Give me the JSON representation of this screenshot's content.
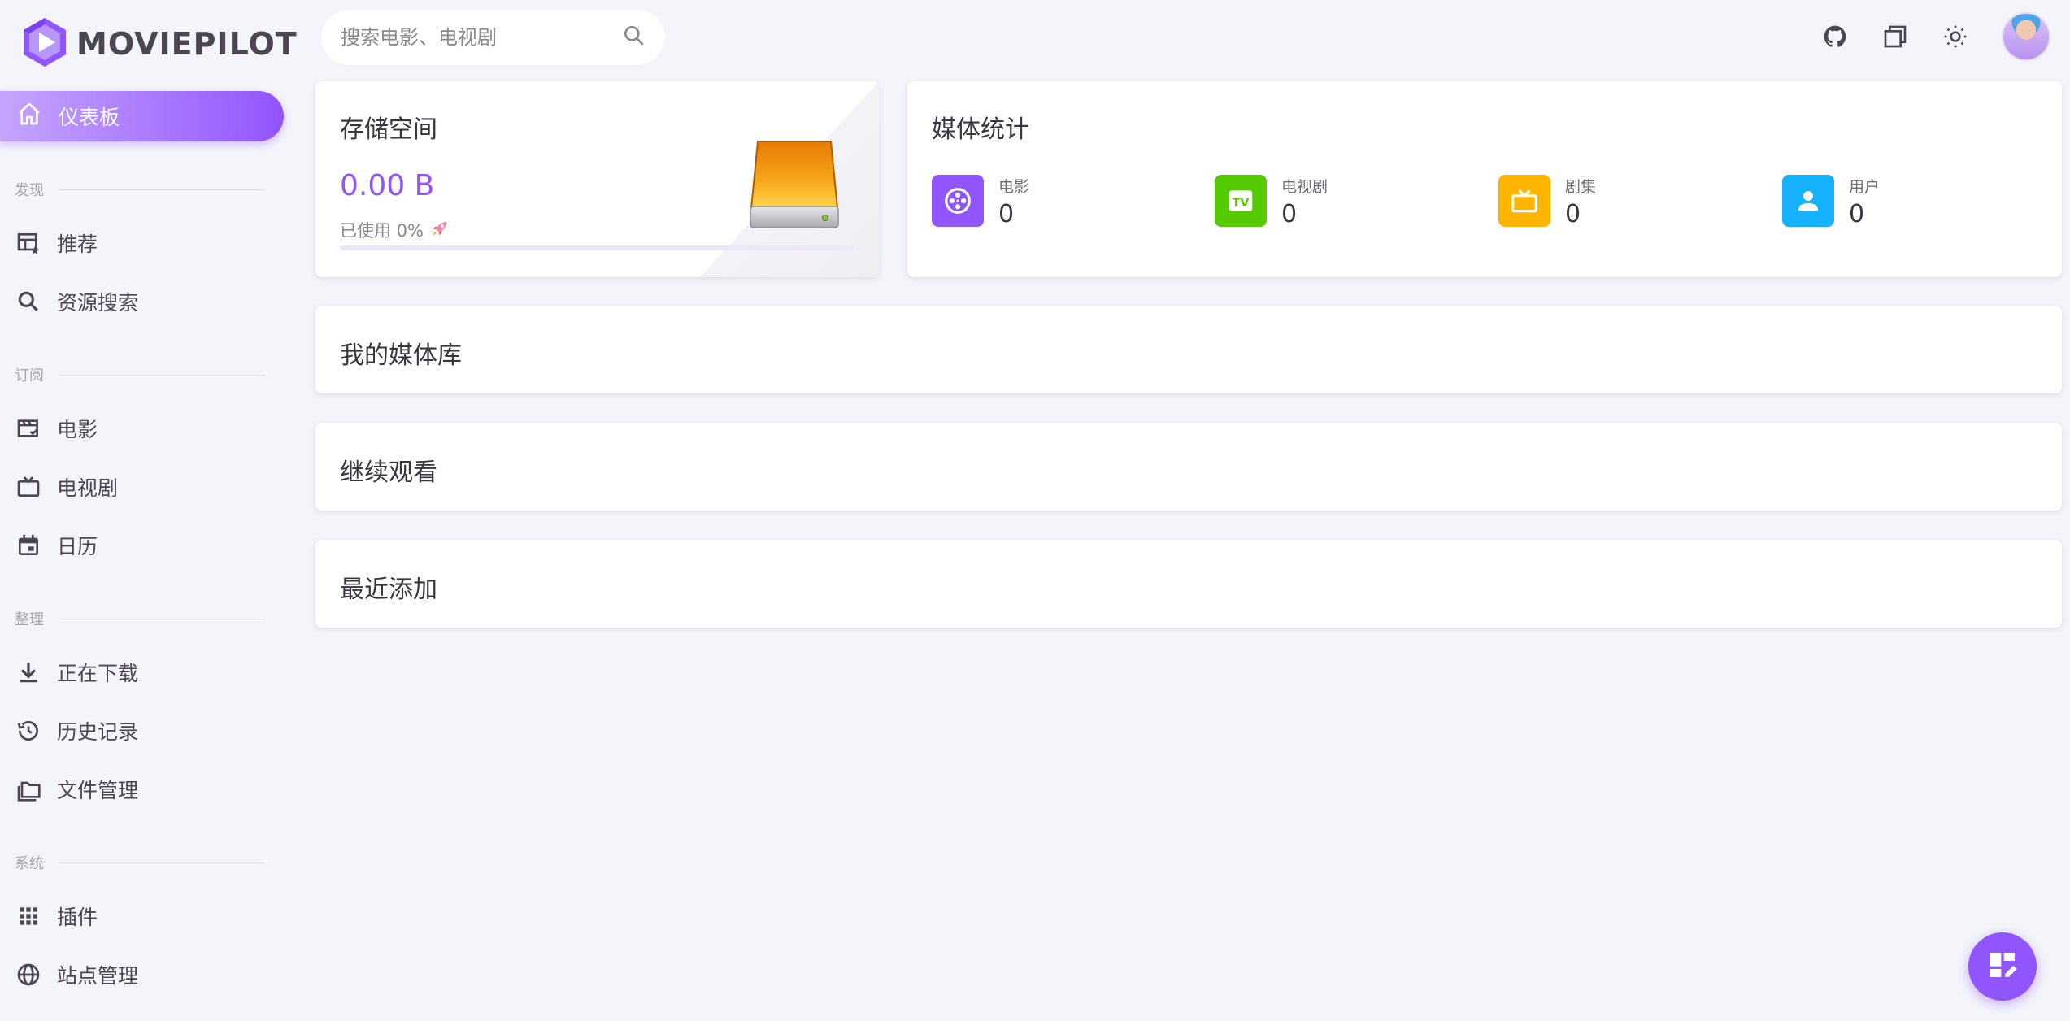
{
  "app": {
    "name": "MOVIEPILOT"
  },
  "search": {
    "placeholder": "搜索电影、电视剧"
  },
  "sidebar": {
    "active": {
      "label": "仪表板"
    },
    "sections": {
      "discover": "发现",
      "subscribe": "订阅",
      "organize": "整理",
      "system": "系统"
    },
    "items": {
      "recommend": "推荐",
      "resource_search": "资源搜索",
      "movies": "电影",
      "tv": "电视剧",
      "calendar": "日历",
      "downloading": "正在下载",
      "history": "历史记录",
      "file_manager": "文件管理",
      "plugins": "插件",
      "sites": "站点管理"
    }
  },
  "storage": {
    "title": "存储空间",
    "value": "0.00 B",
    "used_label": "已使用 0%",
    "used_percent": 0
  },
  "media_stats": {
    "title": "媒体统计",
    "items": [
      {
        "label": "电影",
        "value": "0",
        "icon": "film-reel-icon",
        "color": "#9155fd"
      },
      {
        "label": "电视剧",
        "value": "0",
        "icon": "tv-box-icon",
        "color": "#56ca00"
      },
      {
        "label": "剧集",
        "value": "0",
        "icon": "television-icon",
        "color": "#ffb400"
      },
      {
        "label": "用户",
        "value": "0",
        "icon": "user-icon",
        "color": "#16b1ff"
      }
    ]
  },
  "cards": {
    "library": "我的媒体库",
    "continue": "继续观看",
    "recent": "最近添加"
  },
  "colors": {
    "primary": "#9155fd",
    "background": "#f4f5fa"
  }
}
